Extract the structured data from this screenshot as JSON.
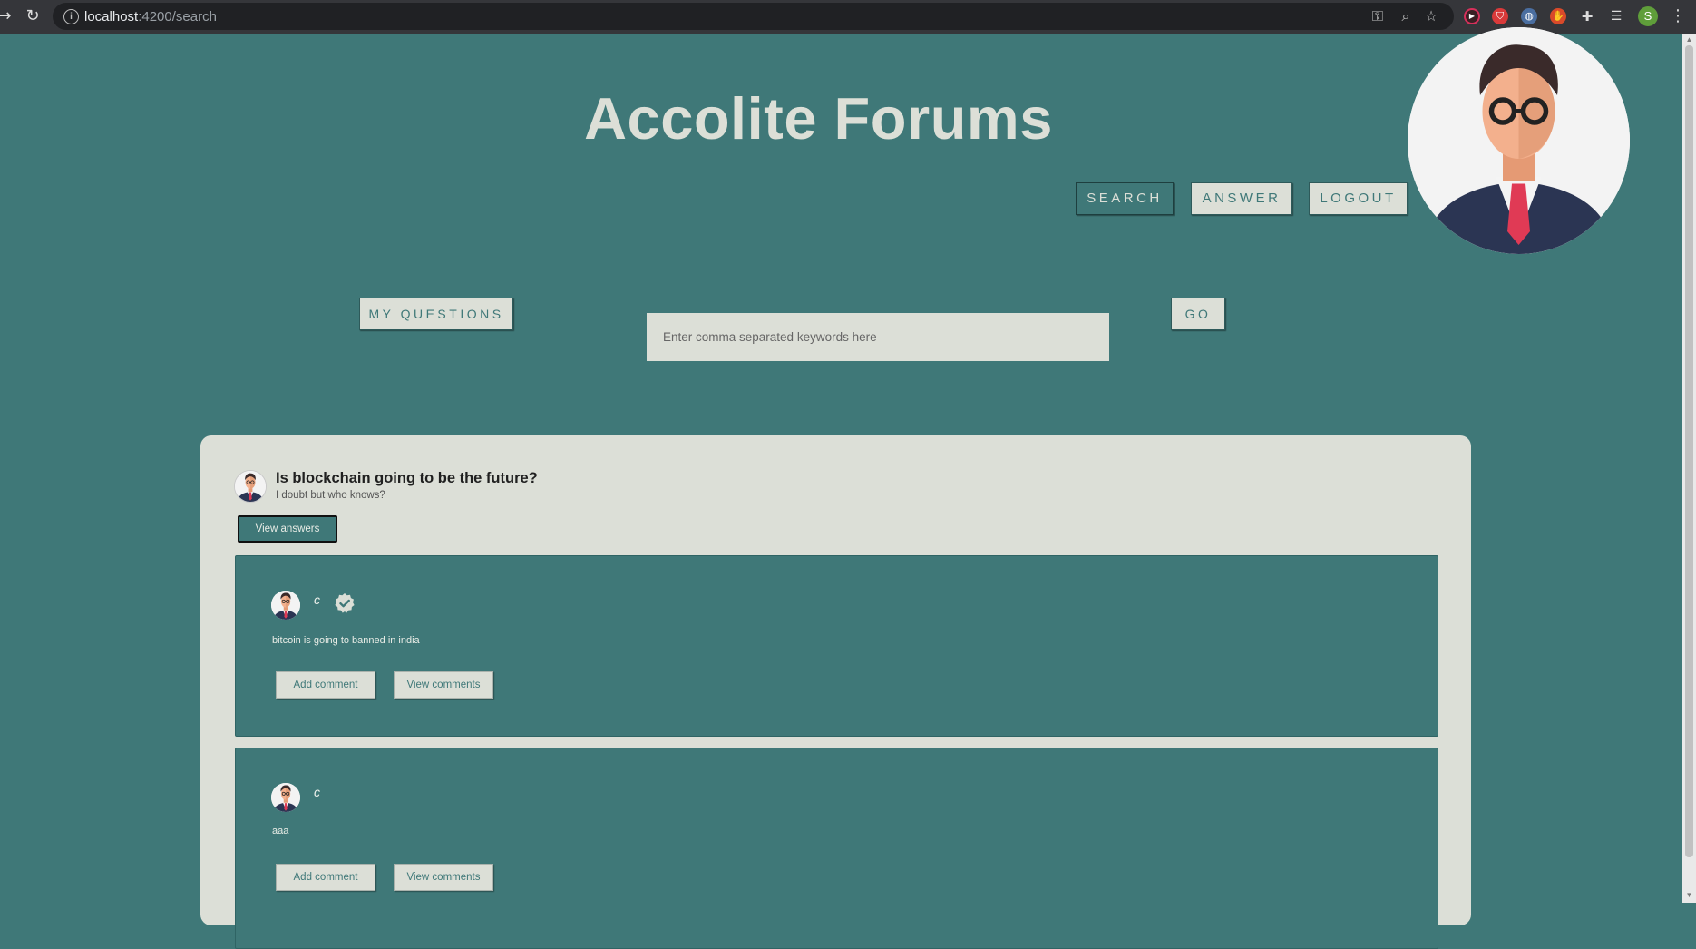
{
  "browser": {
    "url_host": "localhost",
    "url_path": ":4200/search",
    "profile_initial": "S"
  },
  "header": {
    "title": "Accolite Forums",
    "nav": {
      "search": "SEARCH",
      "answer": "ANSWER",
      "logout": "LOGOUT"
    }
  },
  "search": {
    "my_questions_label": "MY QUESTIONS",
    "placeholder": "Enter comma separated keywords here",
    "go_label": "GO"
  },
  "question": {
    "title": "Is blockchain going to be the future?",
    "description": "I doubt but who knows?",
    "view_answers_label": "View answers",
    "answers": [
      {
        "author": "c",
        "verified": true,
        "text": "bitcoin is going to banned in india",
        "add_comment_label": "Add comment",
        "view_comments_label": "View comments"
      },
      {
        "author": "c",
        "verified": false,
        "text": "aaa",
        "add_comment_label": "Add comment",
        "view_comments_label": "View comments"
      }
    ]
  },
  "colors": {
    "page_bg": "#3f7878",
    "card_bg": "#dcdfd7",
    "accent": "#3f7878"
  }
}
